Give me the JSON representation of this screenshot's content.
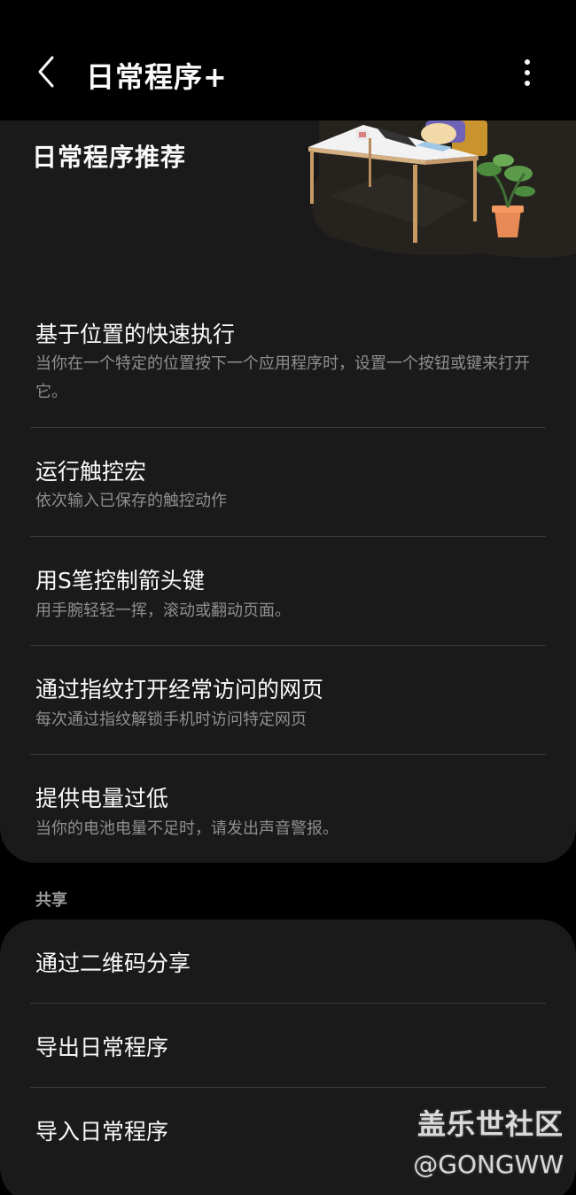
{
  "appbar": {
    "title": "日常程序+",
    "back_icon": "chevron-left-icon",
    "more_icon": "more-vertical-icon"
  },
  "recommendations": {
    "heading": "日常程序推荐",
    "items": [
      {
        "title": "基于位置的快速执行",
        "subtitle": "当你在一个特定的位置按下一个应用程序时，设置一个按钮或键来打开它。"
      },
      {
        "title": "运行触控宏",
        "subtitle": "依次输入已保存的触控动作"
      },
      {
        "title": "用S笔控制箭头键",
        "subtitle": "用手腕轻轻一挥，滚动或翻动页面。"
      },
      {
        "title": "通过指纹打开经常访问的网页",
        "subtitle": "每次通过指纹解锁手机时访问特定网页"
      },
      {
        "title": "提供电量过低",
        "subtitle": "当你的电池电量不足时，请发出声音警报。"
      }
    ]
  },
  "share": {
    "label": "共享",
    "items": [
      {
        "label": "通过二维码分享"
      },
      {
        "label": "导出日常程序"
      },
      {
        "label": "导入日常程序"
      }
    ]
  },
  "watermark": {
    "brand": "盖乐世社区",
    "handle": "@GONGWW"
  },
  "colors": {
    "background": "#000000",
    "card": "#1a1a1a",
    "primary_text": "#fafafa",
    "secondary_text": "#8f8f8f",
    "divider": "#3a3a3a"
  }
}
